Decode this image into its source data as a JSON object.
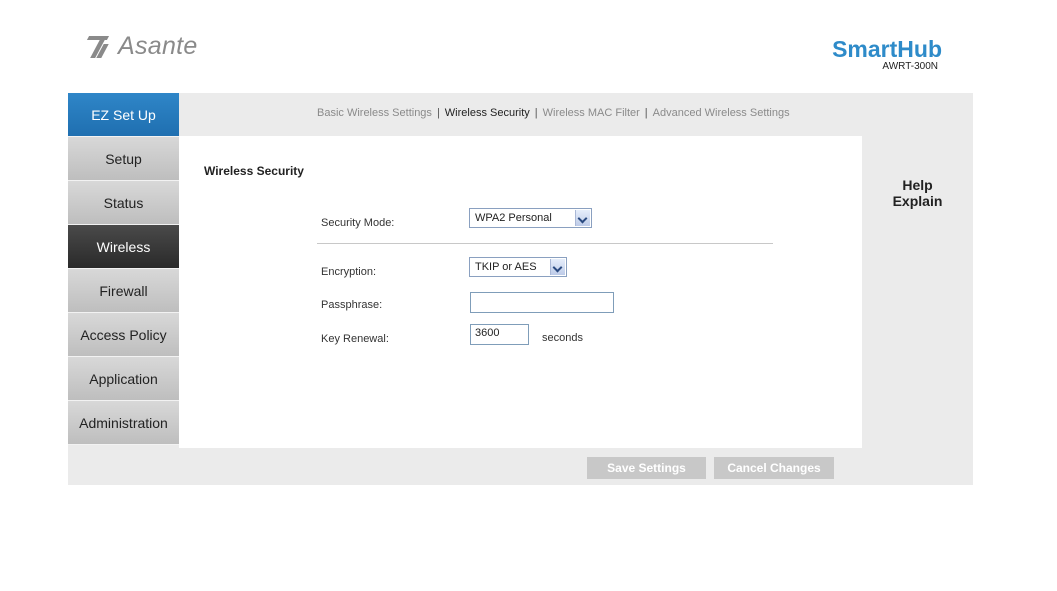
{
  "header": {
    "logo_text": "Asante",
    "brand_title": "SmartHub",
    "brand_model": "AWRT-300N"
  },
  "sidebar": {
    "items": [
      {
        "label": "EZ Set Up"
      },
      {
        "label": "Setup"
      },
      {
        "label": "Status"
      },
      {
        "label": "Wireless"
      },
      {
        "label": "Firewall"
      },
      {
        "label": "Access Policy"
      },
      {
        "label": "Application"
      },
      {
        "label": "Administration"
      }
    ]
  },
  "subnav": {
    "basic": "Basic Wireless Settings",
    "security": "Wireless Security",
    "mac": "Wireless MAC Filter",
    "advanced": "Advanced Wireless Settings",
    "sep": "|"
  },
  "form": {
    "section_title": "Wireless Security",
    "security_mode_label": "Security Mode:",
    "security_mode_value": "WPA2 Personal",
    "encryption_label": "Encryption:",
    "encryption_value": "TKIP or AES",
    "passphrase_label": "Passphrase:",
    "passphrase_value": "",
    "key_renewal_label": "Key Renewal:",
    "key_renewal_value": "3600",
    "key_renewal_unit": "seconds"
  },
  "help": {
    "help": "Help",
    "explain": "Explain"
  },
  "actions": {
    "save": "Save Settings",
    "cancel": "Cancel Changes"
  },
  "colors": {
    "accent": "#2e8bc9",
    "ez_nav": "#2576b8",
    "active_nav": "#333333",
    "button": "#c8c8c8"
  }
}
